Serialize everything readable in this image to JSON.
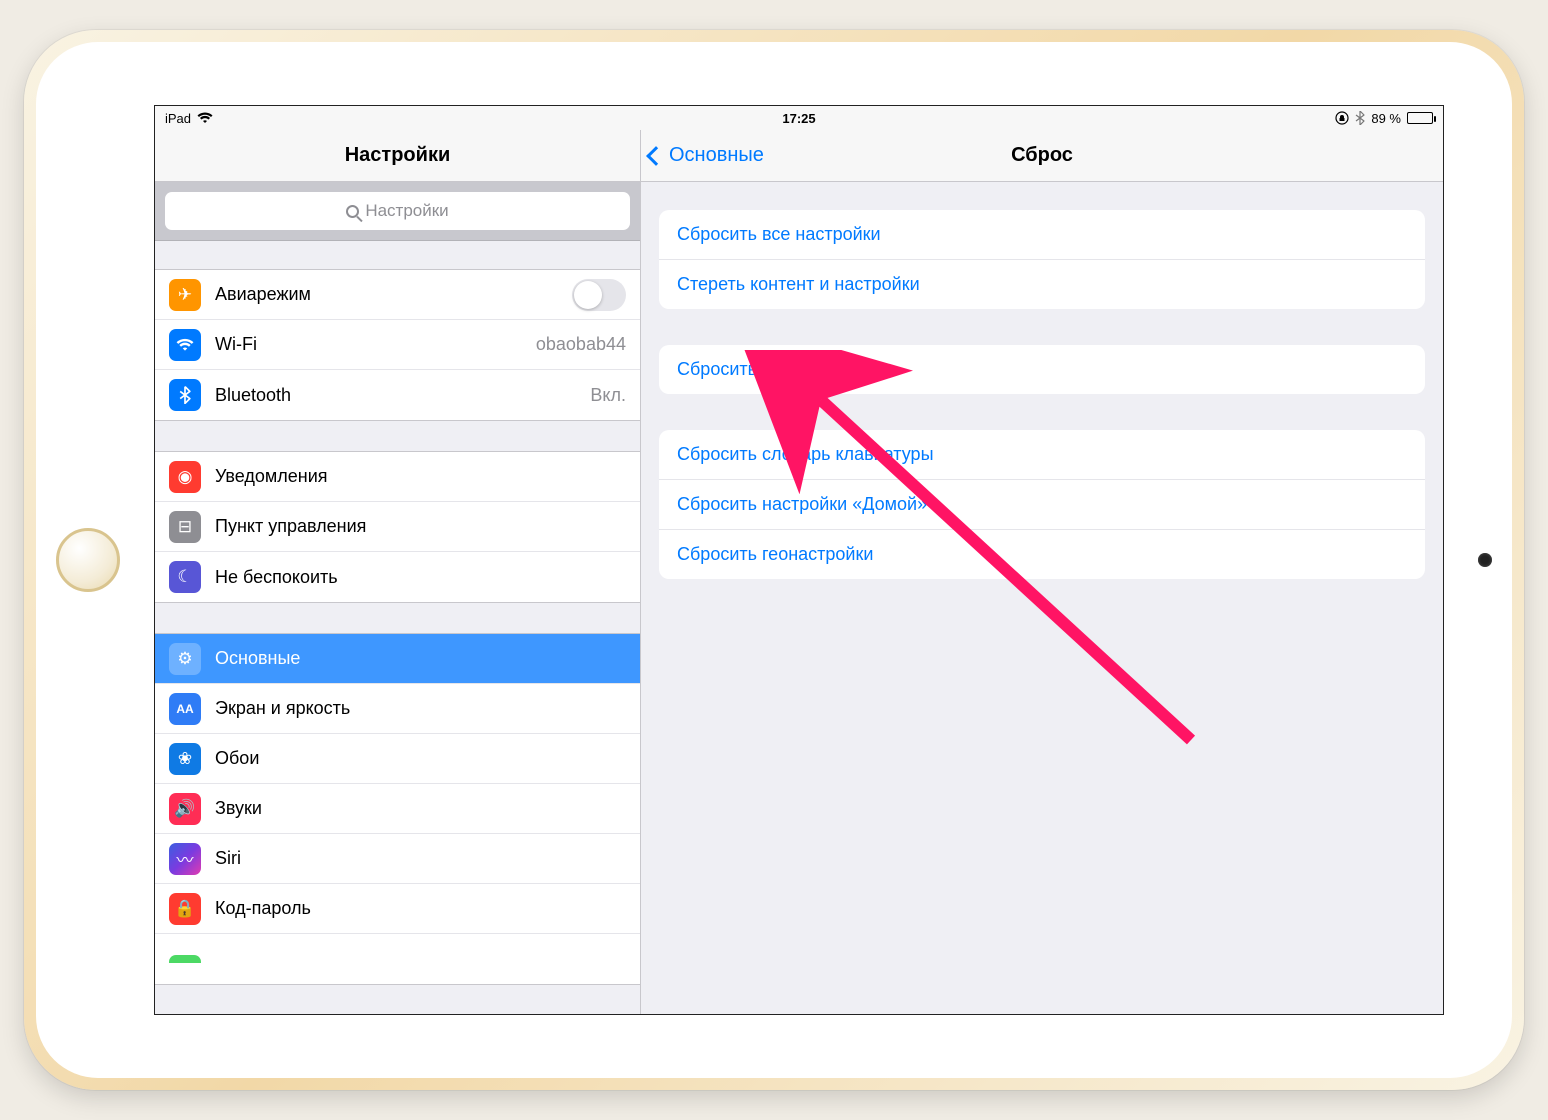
{
  "status": {
    "device": "iPad",
    "time": "17:25",
    "battery_pct": "89 %",
    "orientation_lock": "⊕",
    "bluetooth": "✱"
  },
  "sidebar": {
    "title": "Настройки",
    "search_placeholder": "Настройки",
    "group1": {
      "airplane": "Авиарежим",
      "wifi": "Wi-Fi",
      "wifi_value": "obaobab44",
      "bluetooth": "Bluetooth",
      "bluetooth_value": "Вкл."
    },
    "group2": {
      "notifications": "Уведомления",
      "control_center": "Пункт управления",
      "dnd": "Не беспокоить"
    },
    "group3": {
      "general": "Основные",
      "display": "Экран и яркость",
      "wallpaper": "Обои",
      "sounds": "Звуки",
      "siri": "Siri",
      "passcode": "Код-пароль"
    }
  },
  "detail": {
    "back_label": "Основные",
    "title": "Сброс",
    "g1": {
      "reset_all": "Сбросить все настройки",
      "erase_all": "Стереть контент и настройки"
    },
    "g2": {
      "reset_network": "Сбросить настройки сети"
    },
    "g3": {
      "reset_keyboard": "Сбросить словарь клавиатуры",
      "reset_home": "Сбросить настройки «Домой»",
      "reset_location": "Сбросить геонастройки"
    }
  },
  "colors": {
    "accent": "#007aff",
    "arrow": "#ff1464"
  }
}
